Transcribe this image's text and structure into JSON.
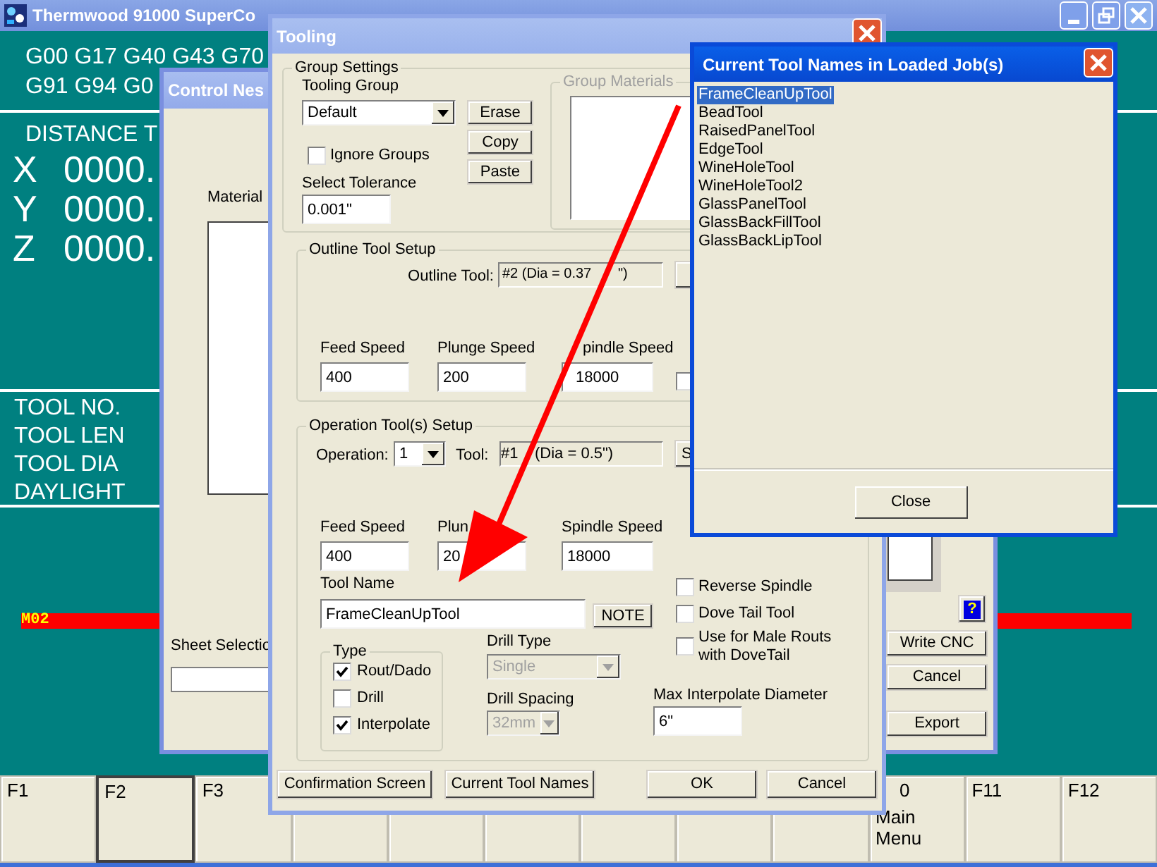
{
  "main_window": {
    "title": "Thermwood 91000 SuperCo",
    "gcode_lines": [
      "G00 G17 G40 G43 G70",
      "G91 G94 G0"
    ],
    "distance_heading": "DISTANCE T",
    "axes": [
      {
        "axis": "X",
        "value": "0000."
      },
      {
        "axis": "Y",
        "value": "0000."
      },
      {
        "axis": "Z",
        "value": "0000."
      }
    ],
    "tool_info": [
      "TOOL NO.",
      "TOOL LEN",
      "TOOL DIA",
      "DAYLIGHT"
    ],
    "status_line": "M02",
    "function_keys": [
      {
        "kind": "key",
        "label": "F1",
        "selected": false
      },
      {
        "kind": "key",
        "label": "F2",
        "selected": true
      },
      {
        "kind": "key",
        "label": "F3",
        "selected": false
      },
      {
        "kind": "blank",
        "selected": false
      },
      {
        "kind": "blank",
        "selected": false
      },
      {
        "kind": "blank",
        "selected": false
      },
      {
        "kind": "blank",
        "selected": false
      },
      {
        "kind": "blank",
        "selected": false
      },
      {
        "kind": "blank",
        "selected": false
      },
      {
        "kind": "cut_key",
        "label": "0",
        "caption": "Main Menu",
        "selected": false
      },
      {
        "kind": "key",
        "label": "F11",
        "selected": false
      },
      {
        "kind": "key",
        "label": "F12",
        "selected": false
      }
    ]
  },
  "control_nest": {
    "title": "Control Nes",
    "material_label": "Material",
    "sheet_label": "Sheet Selectio",
    "help_button": "?",
    "buttons": [
      "Write CNC",
      "Cancel",
      "Export"
    ]
  },
  "tooling": {
    "title": "Tooling",
    "group_settings": {
      "legend": "Group Settings",
      "tooling_group_label": "Tooling Group",
      "tooling_group_value": "Default",
      "buttons": [
        "Erase",
        "Copy",
        "Paste"
      ],
      "ignore_groups": {
        "label": "Ignore Groups",
        "checked": false
      },
      "tolerance_label": "Select Tolerance",
      "tolerance_value": "0.001\"",
      "group_materials_label": "Group Materials"
    },
    "outline": {
      "legend": "Outline Tool Setup",
      "tool_label": "Outline Tool:",
      "tool_value_parts": [
        "#2  (Dia = 0.37",
        "\")"
      ],
      "speeds": [
        {
          "label": "Feed Speed",
          "value": "400"
        },
        {
          "label": "Plunge Speed",
          "value": "200"
        },
        {
          "label": "pindle Speed",
          "value": "18000"
        }
      ],
      "option_checkbox": {
        "checked": false
      }
    },
    "operation": {
      "legend": "Operation Tool(s) Setup",
      "operation_label": "Operation:",
      "operation_value": "1",
      "tool_label": "Tool:",
      "tool_value_parts": [
        "#1",
        "(Dia = 0.5\")"
      ],
      "side_button": "S",
      "speeds": [
        {
          "label": "Feed Speed",
          "value": "400"
        },
        {
          "label": "Plun",
          "value": "20"
        },
        {
          "label": "Spindle Speed",
          "value": "18000"
        }
      ],
      "tool_name_label": "Tool Name",
      "tool_name_value": "FrameCleanUpTool",
      "note_button": "NOTE",
      "type": {
        "legend": "Type",
        "options": [
          {
            "label": "Rout/Dado",
            "checked": true
          },
          {
            "label": "Drill",
            "checked": false
          },
          {
            "label": "Interpolate",
            "checked": true
          }
        ]
      },
      "drill_type": {
        "label": "Drill Type",
        "value": "Single",
        "disabled": true
      },
      "drill_spacing": {
        "label": "Drill Spacing",
        "value": "32mm",
        "disabled": true
      },
      "options": [
        {
          "label": "Reverse Spindle",
          "checked": false
        },
        {
          "label": "Dove Tail Tool",
          "checked": false
        },
        {
          "label": "Use for Male Routs with DoveTail",
          "checked": false
        }
      ],
      "max_interpolate_label": "Max Interpolate Diameter",
      "max_interpolate_value": "6\""
    },
    "footer_buttons": [
      "Confirmation Screen",
      "Current Tool Names",
      "OK",
      "Cancel"
    ]
  },
  "current_tool_names": {
    "title": "Current Tool Names in Loaded Job(s)",
    "items": [
      {
        "label": "FrameCleanUpTool",
        "selected": true
      },
      {
        "label": "BeadTool",
        "selected": false
      },
      {
        "label": "RaisedPanelTool",
        "selected": false
      },
      {
        "label": "EdgeTool",
        "selected": false
      },
      {
        "label": "WineHoleTool",
        "selected": false
      },
      {
        "label": "WineHoleTool2",
        "selected": false
      },
      {
        "label": "GlassPanelTool",
        "selected": false
      },
      {
        "label": "GlassBackFillTool",
        "selected": false
      },
      {
        "label": "GlassBackLipTool",
        "selected": false
      }
    ],
    "close_button": "Close"
  }
}
